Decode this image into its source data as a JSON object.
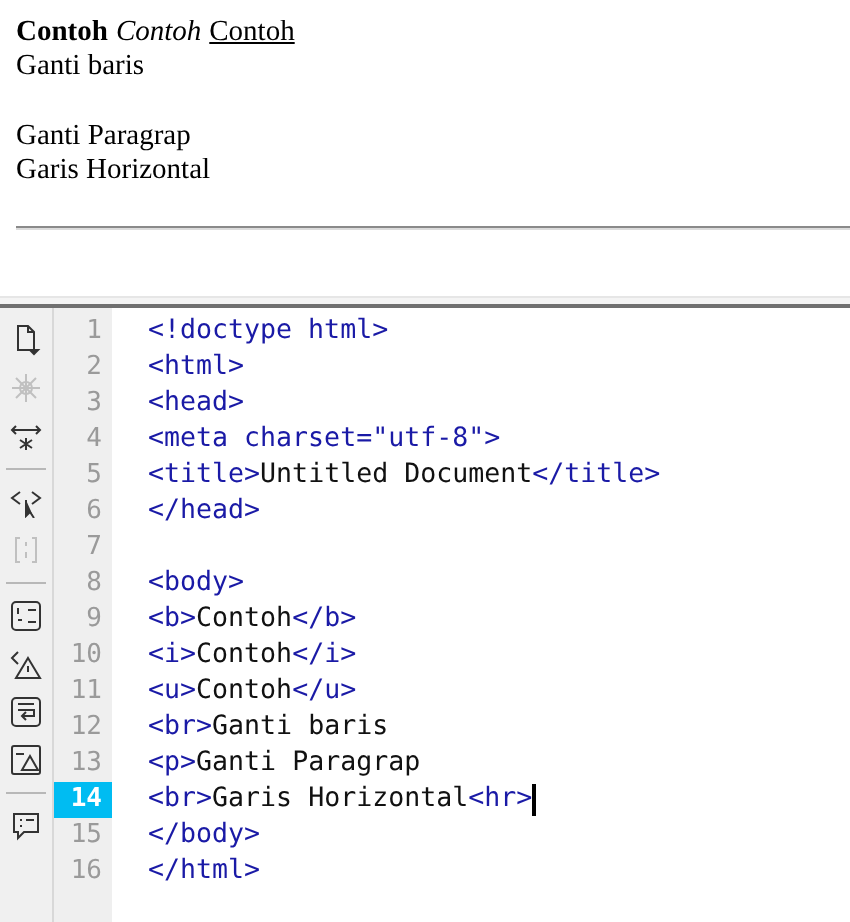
{
  "design_view": {
    "lines": [
      {
        "kind": "line",
        "segments": [
          {
            "kind": "bold",
            "text": "Contoh"
          },
          {
            "kind": "italic",
            "text": "Contoh"
          },
          {
            "kind": "underline",
            "text": "Contoh"
          }
        ]
      },
      {
        "kind": "line",
        "segments": [
          {
            "kind": "plain",
            "text": "Ganti baris"
          }
        ]
      },
      {
        "kind": "paragraph",
        "segments": [
          {
            "kind": "plain",
            "text": "Ganti Paragrap"
          }
        ]
      },
      {
        "kind": "line",
        "segments": [
          {
            "kind": "plain",
            "text": "Garis Horizontal"
          }
        ]
      },
      {
        "kind": "rule"
      }
    ]
  },
  "code_toolbar": [
    {
      "kind": "file",
      "disabled": false
    },
    {
      "kind": "debug",
      "disabled": true
    },
    {
      "kind": "expand",
      "disabled": false
    },
    {
      "kind": "separator"
    },
    {
      "kind": "select-tag",
      "disabled": false
    },
    {
      "kind": "braces",
      "disabled": true
    },
    {
      "kind": "separator"
    },
    {
      "kind": "line-numbers",
      "disabled": false
    },
    {
      "kind": "warning",
      "disabled": false
    },
    {
      "kind": "wrap",
      "disabled": false
    },
    {
      "kind": "highlight",
      "disabled": false
    },
    {
      "kind": "separator"
    },
    {
      "kind": "comment",
      "disabled": false
    }
  ],
  "code_lines": [
    {
      "number": "1",
      "selected": false,
      "segments": [
        {
          "kind": "tag",
          "text": "<!doctype html>"
        }
      ]
    },
    {
      "number": "2",
      "selected": false,
      "segments": [
        {
          "kind": "tag",
          "text": "<html>"
        }
      ]
    },
    {
      "number": "3",
      "selected": false,
      "segments": [
        {
          "kind": "tag",
          "text": "<head>"
        }
      ]
    },
    {
      "number": "4",
      "selected": false,
      "segments": [
        {
          "kind": "tag",
          "text": "<meta charset=\"utf-8\">"
        }
      ]
    },
    {
      "number": "5",
      "selected": false,
      "segments": [
        {
          "kind": "tag",
          "text": "<title>"
        },
        {
          "kind": "text",
          "text": "Untitled Document"
        },
        {
          "kind": "tag",
          "text": "</title>"
        }
      ]
    },
    {
      "number": "6",
      "selected": false,
      "segments": [
        {
          "kind": "tag",
          "text": "</head>"
        }
      ]
    },
    {
      "number": "7",
      "selected": false
    },
    {
      "number": "8",
      "selected": false,
      "segments": [
        {
          "kind": "tag",
          "text": "<body>"
        }
      ]
    },
    {
      "number": "9",
      "selected": false,
      "segments": [
        {
          "kind": "tag",
          "text": "<b>"
        },
        {
          "kind": "text",
          "text": "Contoh"
        },
        {
          "kind": "tag",
          "text": "</b>"
        }
      ]
    },
    {
      "number": "10",
      "selected": false,
      "segments": [
        {
          "kind": "tag",
          "text": "<i>"
        },
        {
          "kind": "text",
          "text": "Contoh"
        },
        {
          "kind": "tag",
          "text": "</i>"
        }
      ]
    },
    {
      "number": "11",
      "selected": false,
      "segments": [
        {
          "kind": "tag",
          "text": "<u>"
        },
        {
          "kind": "text",
          "text": "Contoh"
        },
        {
          "kind": "tag",
          "text": "</u>"
        }
      ]
    },
    {
      "number": "12",
      "selected": false,
      "segments": [
        {
          "kind": "tag",
          "text": "<br>"
        },
        {
          "kind": "text",
          "text": "Ganti baris"
        }
      ]
    },
    {
      "number": "13",
      "selected": false,
      "segments": [
        {
          "kind": "tag",
          "text": "<p>"
        },
        {
          "kind": "text",
          "text": "Ganti Paragrap"
        }
      ]
    },
    {
      "number": "14",
      "selected": true,
      "segments": [
        {
          "kind": "tag",
          "text": "<br>"
        },
        {
          "kind": "text",
          "text": "Garis Horizontal"
        },
        {
          "kind": "tag",
          "text": "<hr>"
        }
      ]
    },
    {
      "number": "15",
      "selected": false,
      "segments": [
        {
          "kind": "tag",
          "text": "</body>"
        }
      ]
    },
    {
      "number": "16",
      "selected": false,
      "segments": [
        {
          "kind": "tag",
          "text": "</html>"
        }
      ]
    }
  ]
}
